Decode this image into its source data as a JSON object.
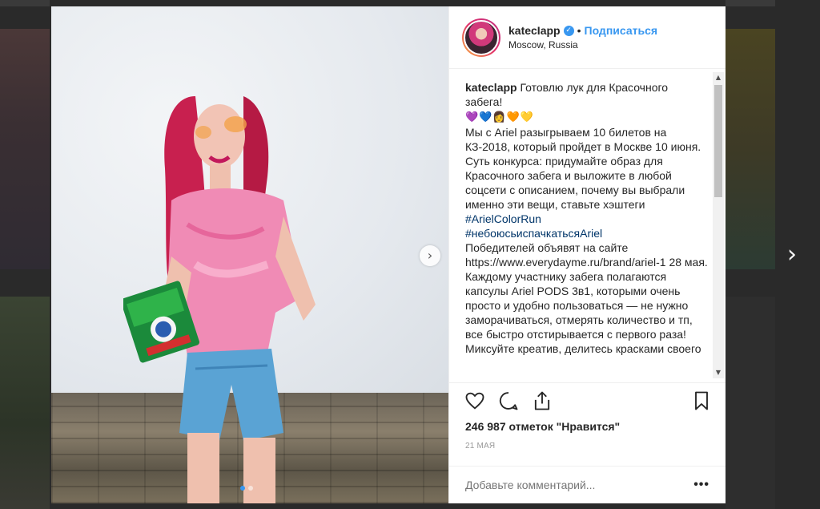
{
  "post": {
    "username": "katecIapp",
    "verified_icon": "verified-badge-icon",
    "separator": "•",
    "follow_label": "Подписаться",
    "location": "Moscow, Russia"
  },
  "caption": {
    "username": "kateclapp",
    "line1": " Готовлю лук для Красочного забега!",
    "emojis": "💜💙👩🧡💛",
    "body1": "Мы с Ariel разыгрываем 10 билетов на КЗ-2018, который пройдет в Москве 10 июня. Суть конкурса: придумайте образ для Красочного забега и выложите в любой соцсети с описанием, почему вы выбрали именно эти вещи, ставьте хэштеги ",
    "hashtag1": "#ArielColorRun",
    "hashtag2": "#небоюсьиспачкатьсяAriel",
    "body2": "Победителей объявят на сайте https://www.everydayme.ru/brand/ariel-1 28 мая.\nКаждому участнику забега полагаются капсулы Ariel PODS 3в1, которыми очень просто и удобно пользоваться — не нужно заморачиваться, отмерять количество и тп, все быстро отстирывается с первого раза! Миксуйте креатив, делитесь красками своего"
  },
  "stats": {
    "likes": "246 987 отметок \"Нравится\"",
    "date": "21 МАЯ"
  },
  "comment": {
    "placeholder": "Добавьте комментарий...",
    "more": "•••"
  },
  "navigation": {
    "next_arrow": "›",
    "carousel_next": "›",
    "scroll_up": "▲",
    "scroll_down": "▼"
  },
  "colors": {
    "accent": "#3897f0",
    "hashtag": "#003569",
    "text": "#262626",
    "muted": "#999999"
  }
}
